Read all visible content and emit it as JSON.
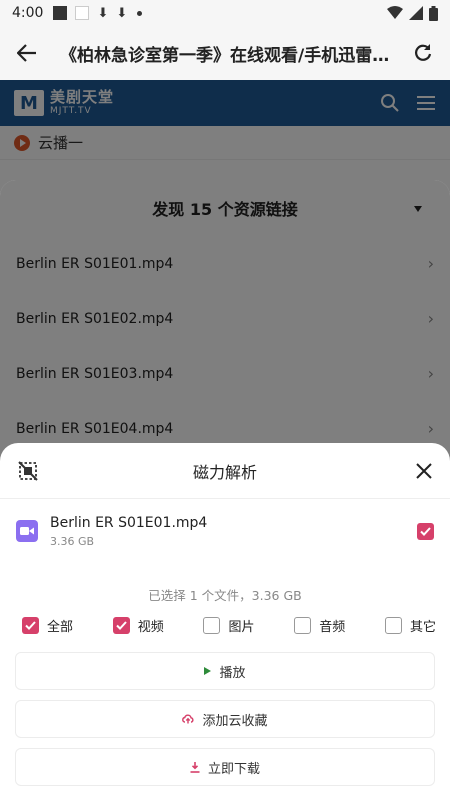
{
  "status_bar": {
    "time": "4:00"
  },
  "app_bar": {
    "title": "《柏林急诊室第一季》在线观看/手机迅雷下载..."
  },
  "site": {
    "logo_mark": "M",
    "logo_cn": "美剧天堂",
    "logo_en": "MJTT.TV",
    "sub_label": "云播一"
  },
  "resources": {
    "header": "发现 15 个资源链接",
    "items": [
      "Berlin ER S01E01.mp4",
      "Berlin ER S01E02.mp4",
      "Berlin ER S01E03.mp4",
      "Berlin ER S01E04.mp4"
    ]
  },
  "magnet_sheet": {
    "title": "磁力解析",
    "file": {
      "name": "Berlin ER S01E01.mp4",
      "size": "3.36 GB",
      "checked": true
    },
    "summary": "已选择 1 个文件，3.36 GB",
    "filters": [
      {
        "label": "全部",
        "checked": true
      },
      {
        "label": "视频",
        "checked": true
      },
      {
        "label": "图片",
        "checked": false
      },
      {
        "label": "音频",
        "checked": false
      },
      {
        "label": "其它",
        "checked": false
      }
    ],
    "actions": {
      "play": "播放",
      "cloud": "添加云收藏",
      "download": "立即下载"
    }
  },
  "colors": {
    "accent": "#d6406a",
    "site_blue": "#1f5b97",
    "file_icon": "#8b6ff0"
  }
}
